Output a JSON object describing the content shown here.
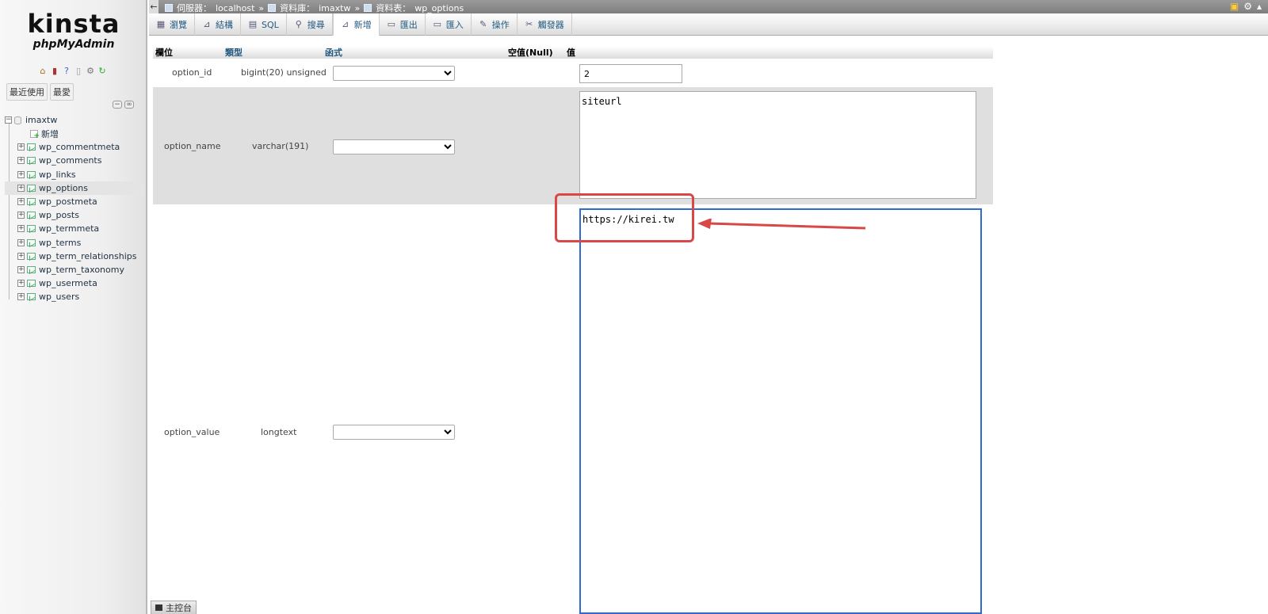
{
  "nav": {
    "logo_brand": "kinsta",
    "logo_sub": "phpMyAdmin",
    "tab_recent": "最近使用",
    "tab_favorites": "最愛",
    "database": "imaxtw",
    "new_item": "新增",
    "tables": [
      "wp_commentmeta",
      "wp_comments",
      "wp_links",
      "wp_options",
      "wp_postmeta",
      "wp_posts",
      "wp_termmeta",
      "wp_terms",
      "wp_term_relationships",
      "wp_term_taxonomy",
      "wp_usermeta",
      "wp_users"
    ],
    "active_table": "wp_options"
  },
  "breadcrumb": {
    "server_label": "伺服器：",
    "server": "localhost",
    "db_label": "資料庫：",
    "db": "imaxtw",
    "table_label": "資料表：",
    "table": "wp_options",
    "sep": "»"
  },
  "menu": {
    "browse": "瀏覽",
    "structure": "結構",
    "sql": "SQL",
    "search": "搜尋",
    "insert": "新增",
    "export": "匯出",
    "import": "匯入",
    "operations": "操作",
    "triggers": "觸發器"
  },
  "table_header": {
    "column": "欄位",
    "type": "類型",
    "function": "函式",
    "null": "空值(Null)",
    "value": "值"
  },
  "rows": [
    {
      "name": "option_id",
      "type": "bigint(20) unsigned",
      "value": "2"
    },
    {
      "name": "option_name",
      "type": "varchar(191)",
      "value": "siteurl"
    },
    {
      "name": "option_value",
      "type": "longtext",
      "value": "https://kirei.tw"
    }
  ],
  "console": {
    "label": "主控台"
  },
  "colors": {
    "annotation": "#d84848",
    "link": "#235a81",
    "focus": "#2d6bd0"
  }
}
